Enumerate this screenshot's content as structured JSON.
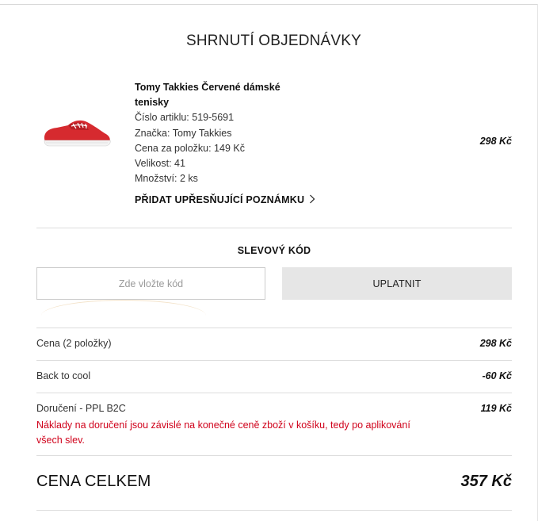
{
  "summary": {
    "title": "SHRNUTÍ OBJEDNÁVKY"
  },
  "product": {
    "name": "Tomy Takkies Červené dámské tenisky",
    "article": "Číslo artiklu: 519-5691",
    "brand": "Značka: Tomy Takkies",
    "unit_price": "Cena za položku: 149 Kč",
    "size": "Velikost: 41",
    "quantity": "Množství: 2 ks",
    "price": "298 Kč",
    "note_link": "PŘIDAT UPŘESŇUJÍCÍ POZNÁMKU",
    "image_icon": "red-sneaker",
    "colors": {
      "shoe": "#d62a2f",
      "sole": "#f4f4f4"
    }
  },
  "discount": {
    "title": "SLEVOVÝ KÓD",
    "placeholder": "Zde vložte kód",
    "value": "",
    "apply_label": "UPLATNIT"
  },
  "totals": {
    "price_label": "Cena (2 položky)",
    "price_value": "298 Kč",
    "promo_label": "Back to cool",
    "promo_value": "-60 Kč",
    "delivery_label": "Doručení - PPL B2C",
    "delivery_value": "119 Kč",
    "delivery_note": "Náklady na doručení jsou závislé na konečné ceně zboží v košíku, tedy po aplikování všech slev.",
    "grand_label": "CENA CELKEM",
    "grand_value": "357 Kč"
  },
  "colors": {
    "warning": "#d0021b",
    "button_bg": "#e6e6e6",
    "divider": "#dddddd"
  }
}
